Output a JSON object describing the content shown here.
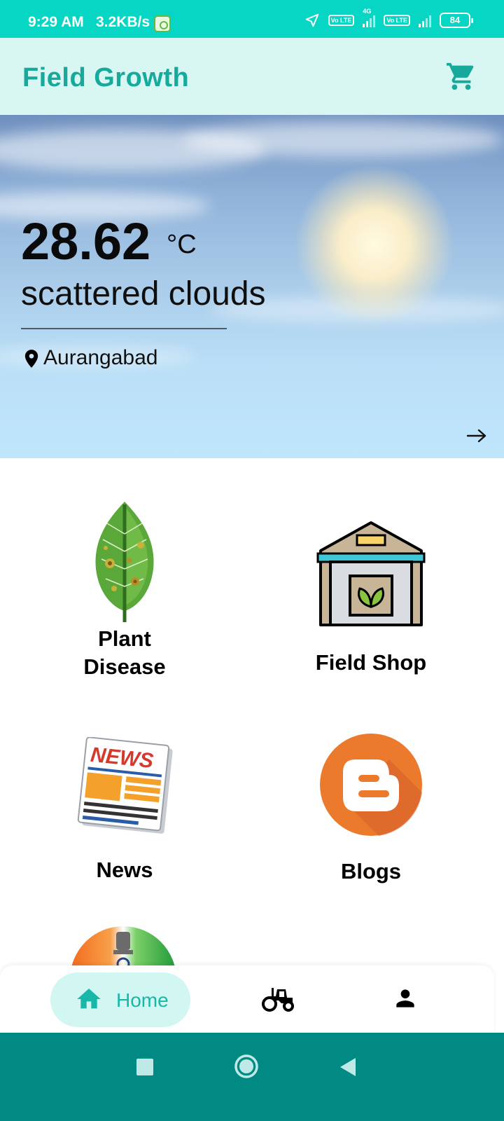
{
  "status_bar": {
    "time": "9:29 AM",
    "speed": "3.2KB/s",
    "network_label": "4G",
    "volte_label": "Vo LTE",
    "battery": "84"
  },
  "app_bar": {
    "title": "Field Growth",
    "cart_icon": "shopping-cart-icon"
  },
  "weather": {
    "temperature": "28.62",
    "unit": "°C",
    "description": "scattered clouds",
    "location": "Aurangabad"
  },
  "tiles": [
    {
      "label_line1": "Plant",
      "label_line2": "Disease",
      "icon": "diseased-leaf-icon"
    },
    {
      "label": "Field Shop",
      "icon": "warehouse-icon"
    },
    {
      "label": "News",
      "icon": "newspaper-icon",
      "icon_text": "NEWS"
    },
    {
      "label": "Blogs",
      "icon": "blogger-icon"
    }
  ],
  "bottom_nav": {
    "home_label": "Home",
    "items": [
      "home-icon",
      "tractor-icon",
      "profile-icon"
    ]
  },
  "colors": {
    "accent": "#17a99b",
    "status_bar": "#08d6c4",
    "app_bar": "#d8f7f3",
    "system_nav": "#018a84"
  }
}
